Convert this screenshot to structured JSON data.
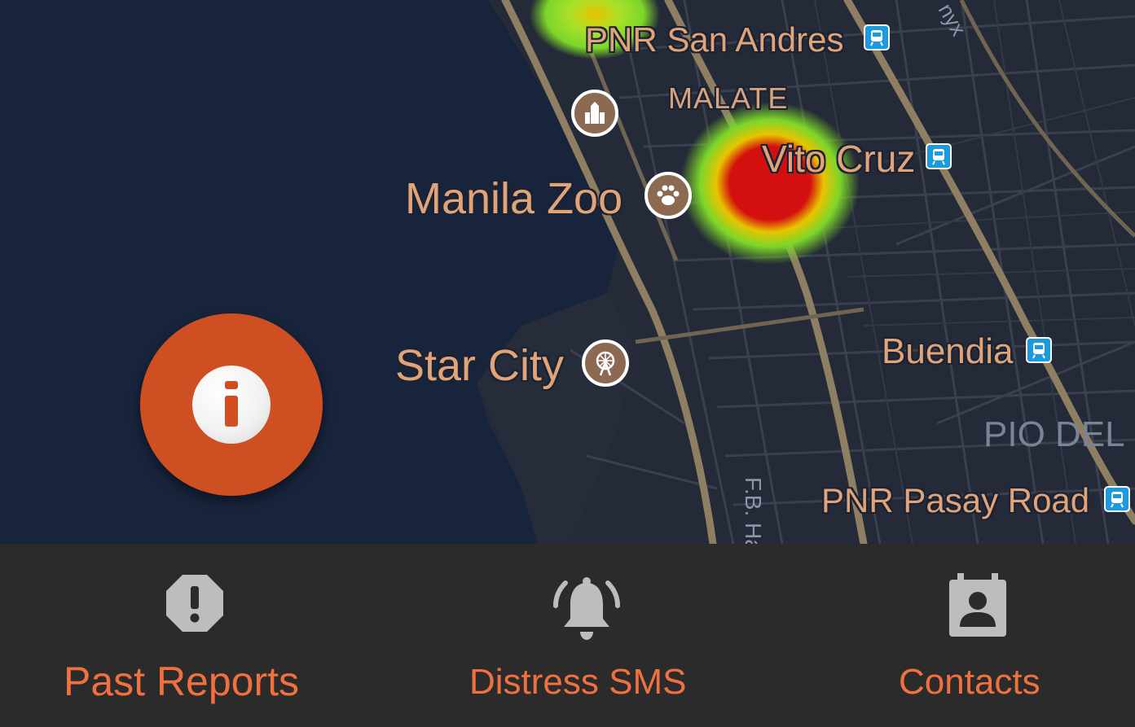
{
  "map": {
    "labels": {
      "pnr_san_andres": "PNR San Andres",
      "malate": "MALATE",
      "vito_cruz": "Vito Cruz",
      "manila_zoo": "Manila Zoo",
      "star_city": "Star City",
      "buendia": "Buendia",
      "pio_del": "PIO DEL",
      "pnr_pasay_road": "PNR Pasay Road",
      "fb_harrison": "F.B. Ha",
      "onyx": "nyx"
    },
    "heatmap_colors": {
      "core": "#d40f0f",
      "mid": "#e8c400",
      "outer": "#7cd62a"
    },
    "icons": {
      "transit": "train-station-icon",
      "church": "church-icon",
      "zoo": "paw-icon",
      "amusement": "ferris-wheel-icon"
    }
  },
  "fab": {
    "icon": "info-icon",
    "color": "#ce4f22"
  },
  "bottom_nav": {
    "items": [
      {
        "label": "Past Reports",
        "icon": "report-icon"
      },
      {
        "label": "Distress SMS",
        "icon": "alarm-bell-icon"
      },
      {
        "label": "Contacts",
        "icon": "contact-card-icon"
      }
    ],
    "label_color": "#f07040",
    "icon_color": "#bdbdbd",
    "background": "#2b2b2b"
  }
}
